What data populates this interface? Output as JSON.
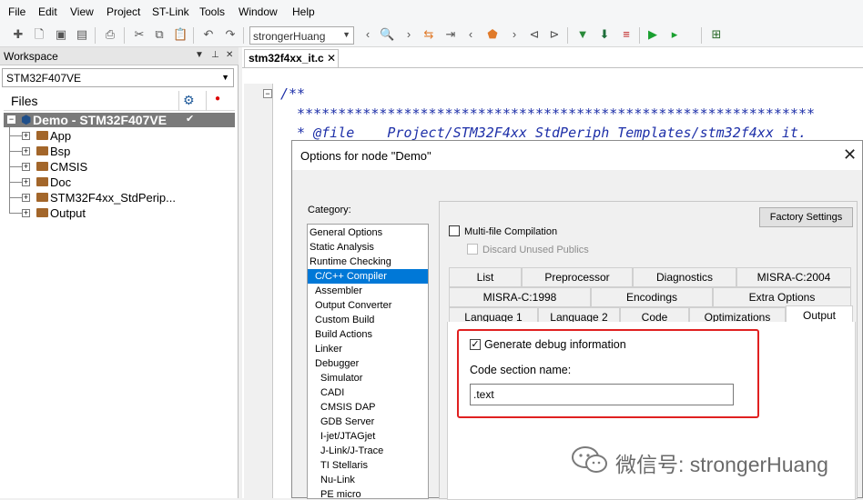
{
  "menu": [
    "File",
    "Edit",
    "View",
    "Project",
    "ST-Link",
    "Tools",
    "Window",
    "Help"
  ],
  "toolbar": {
    "config_value": "strongerHuang"
  },
  "workspace": {
    "title": "Workspace",
    "config": "STM32F407VE",
    "files_header": "Files",
    "root": "Demo - STM32F407VE",
    "items": [
      "App",
      "Bsp",
      "CMSIS",
      "Doc",
      "STM32F4xx_StdPerip...",
      "Output"
    ]
  },
  "editor": {
    "tab": "stm32f4xx_it.c",
    "lines": [
      "/**",
      "  ***************************************************************",
      "  * @file    Project/STM32F4xx_StdPeriph_Templates/stm32f4xx_it."
    ]
  },
  "dialog": {
    "title": "Options for node \"Demo\"",
    "category_label": "Category:",
    "categories": [
      "General Options",
      "Static Analysis",
      "Runtime Checking",
      "C/C++ Compiler",
      "Assembler",
      "Output Converter",
      "Custom Build",
      "Build Actions",
      "Linker",
      "Debugger",
      "Simulator",
      "CADI",
      "CMSIS DAP",
      "GDB Server",
      "I-jet/JTAGjet",
      "J-Link/J-Trace",
      "TI Stellaris",
      "Nu-Link",
      "PE micro"
    ],
    "selected_category": "C/C++ Compiler",
    "factory_settings": "Factory Settings",
    "multifile": "Multi-file Compilation",
    "discard": "Discard Unused Publics",
    "tabs_row1": [
      "List",
      "Preprocessor",
      "Diagnostics",
      "MISRA-C:2004"
    ],
    "tabs_row2": [
      "MISRA-C:1998",
      "Encodings",
      "Extra Options"
    ],
    "tabs_row3": [
      "Language 1",
      "Language 2",
      "Code",
      "Optimizations",
      "Output"
    ],
    "active_tab": "Output",
    "generate_debug": "Generate debug information",
    "generate_debug_checked": true,
    "code_section_label": "Code section name:",
    "code_section_value": ".text"
  },
  "watermark": "微信号: strongerHuang"
}
